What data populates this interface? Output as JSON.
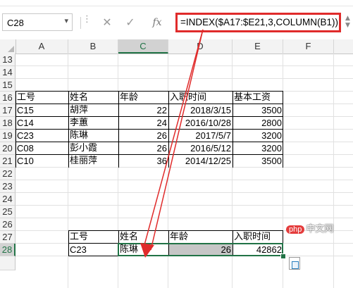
{
  "name_box": {
    "value": "C28"
  },
  "formula_bar": {
    "cancel_icon": "close-icon",
    "enter_icon": "check-icon",
    "fx_label": "fx",
    "formula": "=INDEX($A17:$E21,3,COLUMN(B1))"
  },
  "columns": [
    "A",
    "B",
    "C",
    "D",
    "E",
    "F"
  ],
  "selected_column": "C",
  "rows": [
    "13",
    "14",
    "15",
    "16",
    "17",
    "18",
    "19",
    "20",
    "21",
    "22",
    "23",
    "24",
    "25",
    "26",
    "27",
    "28"
  ],
  "selected_row": "28",
  "source_table": {
    "headers": [
      "工号",
      "姓名",
      "年龄",
      "入职时间",
      "基本工资"
    ],
    "rows": [
      [
        "C15",
        "胡萍",
        "22",
        "2018/3/15",
        "3500"
      ],
      [
        "C14",
        "李蕙",
        "24",
        "2016/10/28",
        "2800"
      ],
      [
        "C23",
        "陈琳",
        "26",
        "2017/5/7",
        "3200"
      ],
      [
        "C08",
        "彭小霞",
        "26",
        "2016/5/12",
        "3200"
      ],
      [
        "C10",
        "桂丽萍",
        "36",
        "2014/12/25",
        "3500"
      ]
    ]
  },
  "lookup_table": {
    "headers": [
      "工号",
      "姓名",
      "年龄",
      "入职时间"
    ],
    "row": [
      "C23",
      "陈琳",
      "26",
      "42862"
    ]
  },
  "watermark": {
    "badge": "php",
    "text": "中文网"
  },
  "colors": {
    "formula_highlight": "#e02b2b",
    "arrow": "#e02b2b",
    "selection": "#217346"
  }
}
